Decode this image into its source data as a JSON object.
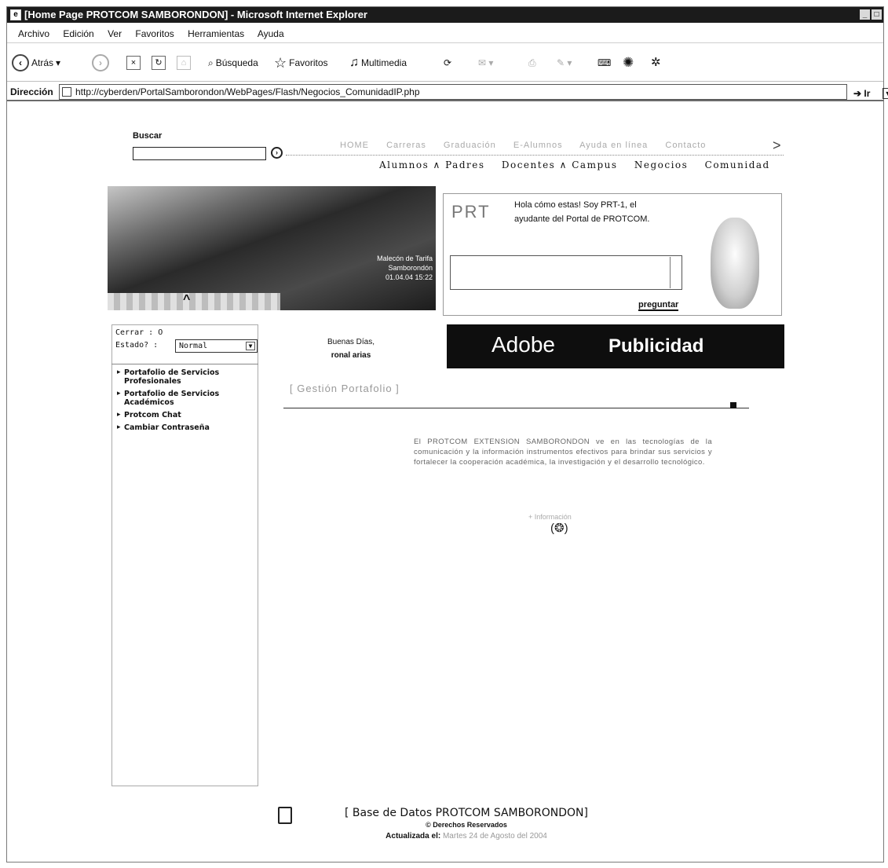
{
  "window": {
    "title": "[Home Page PROTCOM SAMBORONDON] - Microsoft Internet Explorer",
    "title_display": "[Home Page PROTCOM SAMBORONDON] - Microsoft Internet Explorer"
  },
  "menu": [
    "Archivo",
    "Edición",
    "Ver",
    "Favoritos",
    "Herramientas",
    "Ayuda"
  ],
  "toolbar": {
    "back": "Atrás",
    "search": "Búsqueda",
    "favorites": "Favoritos",
    "media": "Multimedia"
  },
  "address": {
    "label": "Dirección",
    "url": "http://cyberden/PortalSamborondon/WebPages/Flash/Negocios_ComunidadIP.php",
    "go": "Ir"
  },
  "page": {
    "search_label": "Buscar",
    "topnav": [
      "HOME",
      "Carreras",
      "Graduación",
      "E-Alumnos",
      "Ayuda en línea",
      "Contacto"
    ],
    "topnav_arrow": ">",
    "subnav": [
      "Alumnos ∧ Padres",
      "Docentes ∧ Campus",
      "Negocios",
      "Comunidad"
    ],
    "banner_caption": [
      "Malecón de Tarifa",
      "Samborondón",
      "01.04.04 15:22"
    ],
    "assistant": {
      "logo": "PRT",
      "message_line1": "Hola cómo estas! Soy PRT-1, el",
      "message_line2": "ayudante del Portal de PROTCOM.",
      "ask_button": "preguntar"
    },
    "session": {
      "cerrar_label": "Cerrar  :",
      "cerrar_value": "O",
      "estado_label": "Estado? :",
      "estado_value": "Normal"
    },
    "links": [
      "Portafolio de Servicios Profesionales",
      "Portafolio de Servicios Académicos",
      "Protcom Chat",
      "Cambiar Contraseña"
    ],
    "greeting": "Buenas Días,",
    "user": "ronal arias",
    "ad": {
      "brand": "Adobe",
      "label": "Publicidad"
    },
    "section_title": "[ Gestión Portafolio ]",
    "paragraph": "El PROTCOM EXTENSION SAMBORONDON ve en las tecnologías de la comunicación y la información instrumentos efectivos para brindar sus servicios y fortalecer la cooperación académica, la investigación y el desarrollo tecnológico.",
    "more_info": "+ Información",
    "more_icon": "(❂)",
    "footer": {
      "title": "[ Base de Datos PROTCOM SAMBORONDON]",
      "rights": "© Derechos Reservados",
      "updated_label": "Actualizada el:",
      "updated_value": "Martes 24 de Agosto del 2004"
    }
  }
}
